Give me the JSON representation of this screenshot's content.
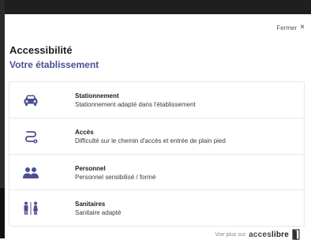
{
  "dialog": {
    "close_label": "Fermer",
    "close_symbol": "×",
    "title": "Accessibilité",
    "subtitle": "Votre établissement"
  },
  "items": [
    {
      "icon": "car-icon",
      "name": "Stationnement",
      "desc": "Stationnement adapté dans l'établissement"
    },
    {
      "icon": "path-icon",
      "name": "Accès",
      "desc": "Difficulté sur le chemin d'accès et entrée de plain pied"
    },
    {
      "icon": "people-icon",
      "name": "Personnel",
      "desc": "Personnel sensibilisé / formé"
    },
    {
      "icon": "restroom-icon",
      "name": "Sanitaires",
      "desc": "Sanitaire adapté"
    }
  ],
  "footer": {
    "prefix": "Voir plus sur",
    "brand_part1": "acces",
    "brand_part2": "libre"
  },
  "colors": {
    "accent": "#4b4f94",
    "icon": "#4b4f94"
  }
}
